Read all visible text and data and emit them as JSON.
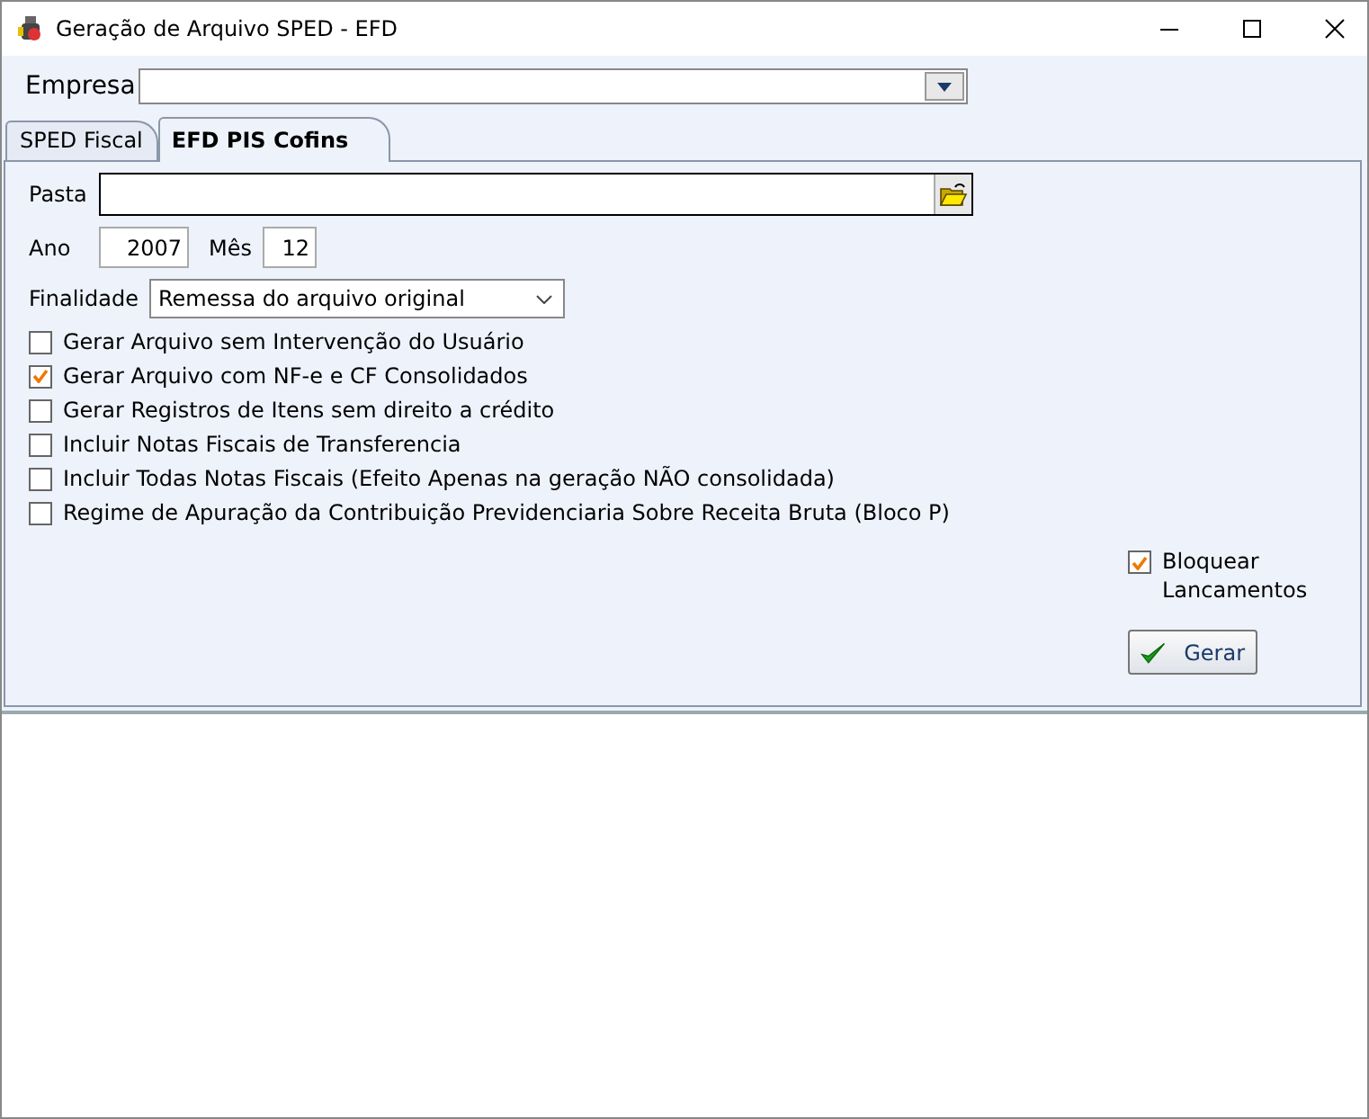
{
  "window": {
    "title": "Geração de Arquivo SPED - EFD"
  },
  "empresa": {
    "label": "Empresa"
  },
  "tabs": [
    {
      "label": "SPED Fiscal",
      "selected": false
    },
    {
      "label": "EFD PIS Cofins",
      "selected": true
    }
  ],
  "pasta": {
    "label": "Pasta"
  },
  "ano": {
    "label": "Ano",
    "value": "2007"
  },
  "mes": {
    "label": "Mês",
    "value": "12"
  },
  "finalidade": {
    "label": "Finalidade",
    "value": "Remessa do arquivo original"
  },
  "options": [
    {
      "label": "Gerar Arquivo sem Intervenção do Usuário",
      "checked": false
    },
    {
      "label": "Gerar Arquivo com NF-e e CF Consolidados",
      "checked": true
    },
    {
      "label": "Gerar Registros de Itens sem direito a crédito",
      "checked": false
    },
    {
      "label": "Incluir Notas Fiscais de Transferencia",
      "checked": false
    },
    {
      "label": "Incluir Todas Notas Fiscais (Efeito Apenas na geração NÃO consolidada)",
      "checked": false
    },
    {
      "label": "Regime de Apuração da Contribuição Previdenciaria Sobre Receita Bruta (Bloco P)",
      "checked": false
    }
  ],
  "bloquear": {
    "label": "Bloquear Lancamentos",
    "checked": true
  },
  "gerar_button": "Gerar"
}
